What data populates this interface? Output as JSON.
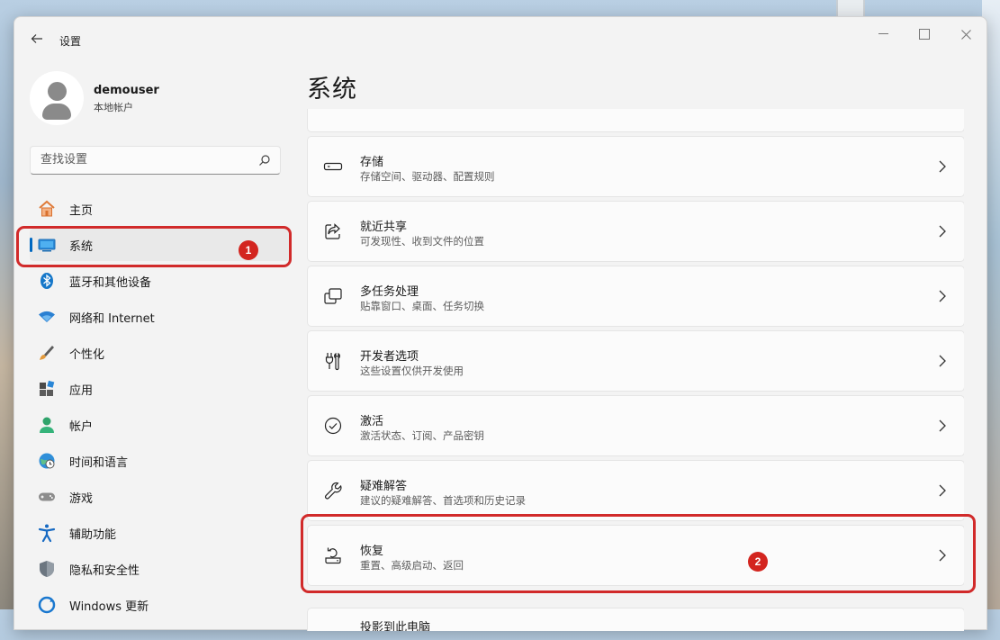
{
  "window": {
    "title": "设置"
  },
  "user": {
    "name": "demouser",
    "account_type": "本地帐户"
  },
  "search": {
    "placeholder": "查找设置"
  },
  "sidebar": {
    "items": [
      {
        "label": "主页",
        "icon": "home-icon"
      },
      {
        "label": "系统",
        "icon": "system-icon",
        "active": true
      },
      {
        "label": "蓝牙和其他设备",
        "icon": "bluetooth-icon"
      },
      {
        "label": "网络和 Internet",
        "icon": "wifi-icon"
      },
      {
        "label": "个性化",
        "icon": "brush-icon"
      },
      {
        "label": "应用",
        "icon": "apps-icon"
      },
      {
        "label": "帐户",
        "icon": "person-icon"
      },
      {
        "label": "时间和语言",
        "icon": "globe-clock-icon"
      },
      {
        "label": "游戏",
        "icon": "gamepad-icon"
      },
      {
        "label": "辅助功能",
        "icon": "accessibility-icon"
      },
      {
        "label": "隐私和安全性",
        "icon": "shield-icon"
      },
      {
        "label": "Windows 更新",
        "icon": "update-icon"
      }
    ]
  },
  "main": {
    "title": "系统",
    "cards": [
      {
        "title": "存储",
        "subtitle": "存储空间、驱动器、配置规则",
        "icon": "storage-drive-icon"
      },
      {
        "title": "就近共享",
        "subtitle": "可发现性、收到文件的位置",
        "icon": "share-icon"
      },
      {
        "title": "多任务处理",
        "subtitle": "贴靠窗口、桌面、任务切换",
        "icon": "multitask-icon"
      },
      {
        "title": "开发者选项",
        "subtitle": "这些设置仅供开发使用",
        "icon": "developer-tools-icon"
      },
      {
        "title": "激活",
        "subtitle": "激活状态、订阅、产品密钥",
        "icon": "activation-check-icon"
      },
      {
        "title": "疑难解答",
        "subtitle": "建议的疑难解答、首选项和历史记录",
        "icon": "wrench-icon"
      },
      {
        "title": "恢复",
        "subtitle": "重置、高级启动、返回",
        "icon": "recovery-icon"
      },
      {
        "title": "投影到此电脑",
        "subtitle": "",
        "icon": "projection-icon"
      }
    ]
  },
  "annotations": [
    {
      "number": "1",
      "target": "系统"
    },
    {
      "number": "2",
      "target": "恢复"
    }
  ],
  "colors": {
    "accent": "#0067c0",
    "annotation": "#d12a2a"
  }
}
